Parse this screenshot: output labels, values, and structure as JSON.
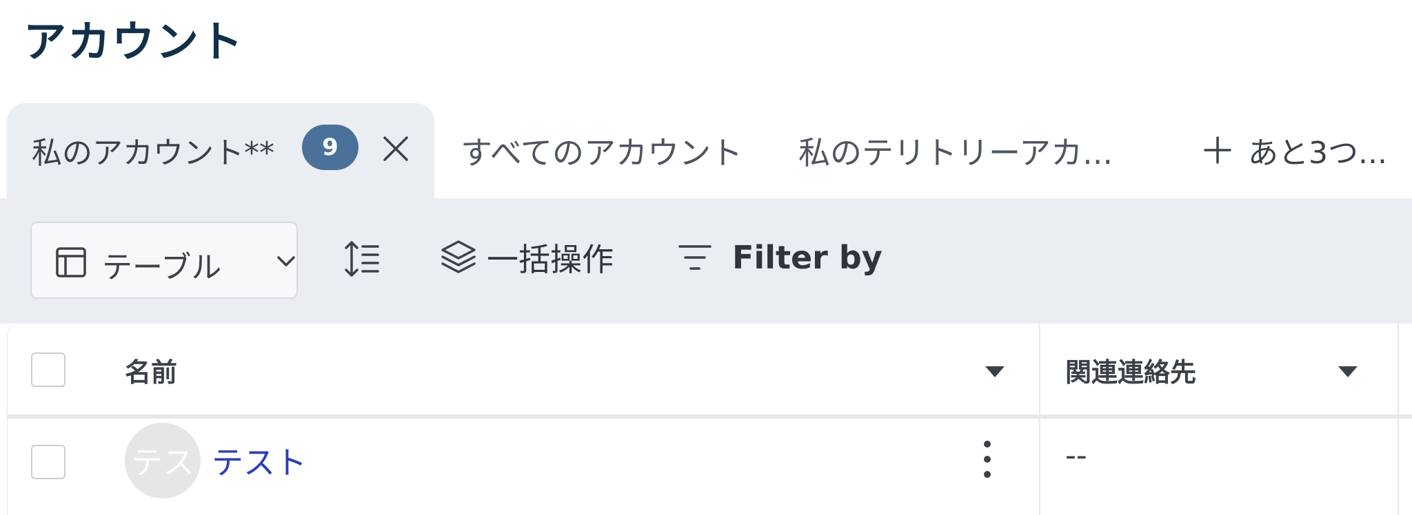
{
  "page": {
    "title": "アカウント"
  },
  "tabs": {
    "active": {
      "label": "私のアカウント**",
      "badge": "9"
    },
    "items": [
      {
        "label": "すべてのアカウント"
      },
      {
        "label": "私のテリトリーアカ..."
      }
    ],
    "more_label": "あと3つ..."
  },
  "toolbar": {
    "view_label": "テーブル",
    "bulk_label": "一括操作",
    "filter_label": "Filter by"
  },
  "table": {
    "columns": [
      {
        "label": "名前"
      },
      {
        "label": "関連連絡先"
      }
    ],
    "rows": [
      {
        "avatar_text": "テス",
        "name": "テスト",
        "related_contact": "--"
      }
    ]
  },
  "colors": {
    "title": "#13304a",
    "badge_bg": "#4a7199",
    "toolbar_bg": "#eaedf2",
    "link": "#2a3fb5"
  },
  "icons": {
    "tab_close": "close-icon",
    "add_tab": "plus-icon",
    "view": "table-icon",
    "view_dropdown": "chevron-down-icon",
    "sort": "line-height-sort-icon",
    "bulk": "layers-icon",
    "filter": "filter-icon",
    "column_sort": "caret-down-icon",
    "row_menu": "more-vertical-icon"
  }
}
